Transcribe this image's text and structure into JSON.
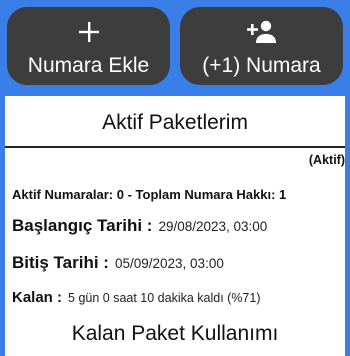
{
  "actions": {
    "add_number": {
      "label": "Numara Ekle",
      "icon": "plus-icon"
    },
    "extra_number": {
      "label": "(+1) Numara",
      "icon": "person-add-icon"
    }
  },
  "package": {
    "title": "Aktif Paketlerim",
    "status": "(Aktif)",
    "summary": "Aktif Numaralar: 0 - Toplam Numara Hakkı: 1",
    "start_label": "Başlangıç Tarihi :",
    "start_value": "29/08/2023, 03:00",
    "end_label": "Bitiş Tarihi :",
    "end_value": "05/09/2023, 03:00",
    "remaining_label": "Kalan :",
    "remaining_value": "5 gün 0 saat 10 dakika kaldı (%71)",
    "usage_title": "Kalan Paket Kullanımı"
  },
  "colors": {
    "background": "#3a7fe8",
    "button": "#3d3d3d",
    "card": "#ffffff"
  }
}
